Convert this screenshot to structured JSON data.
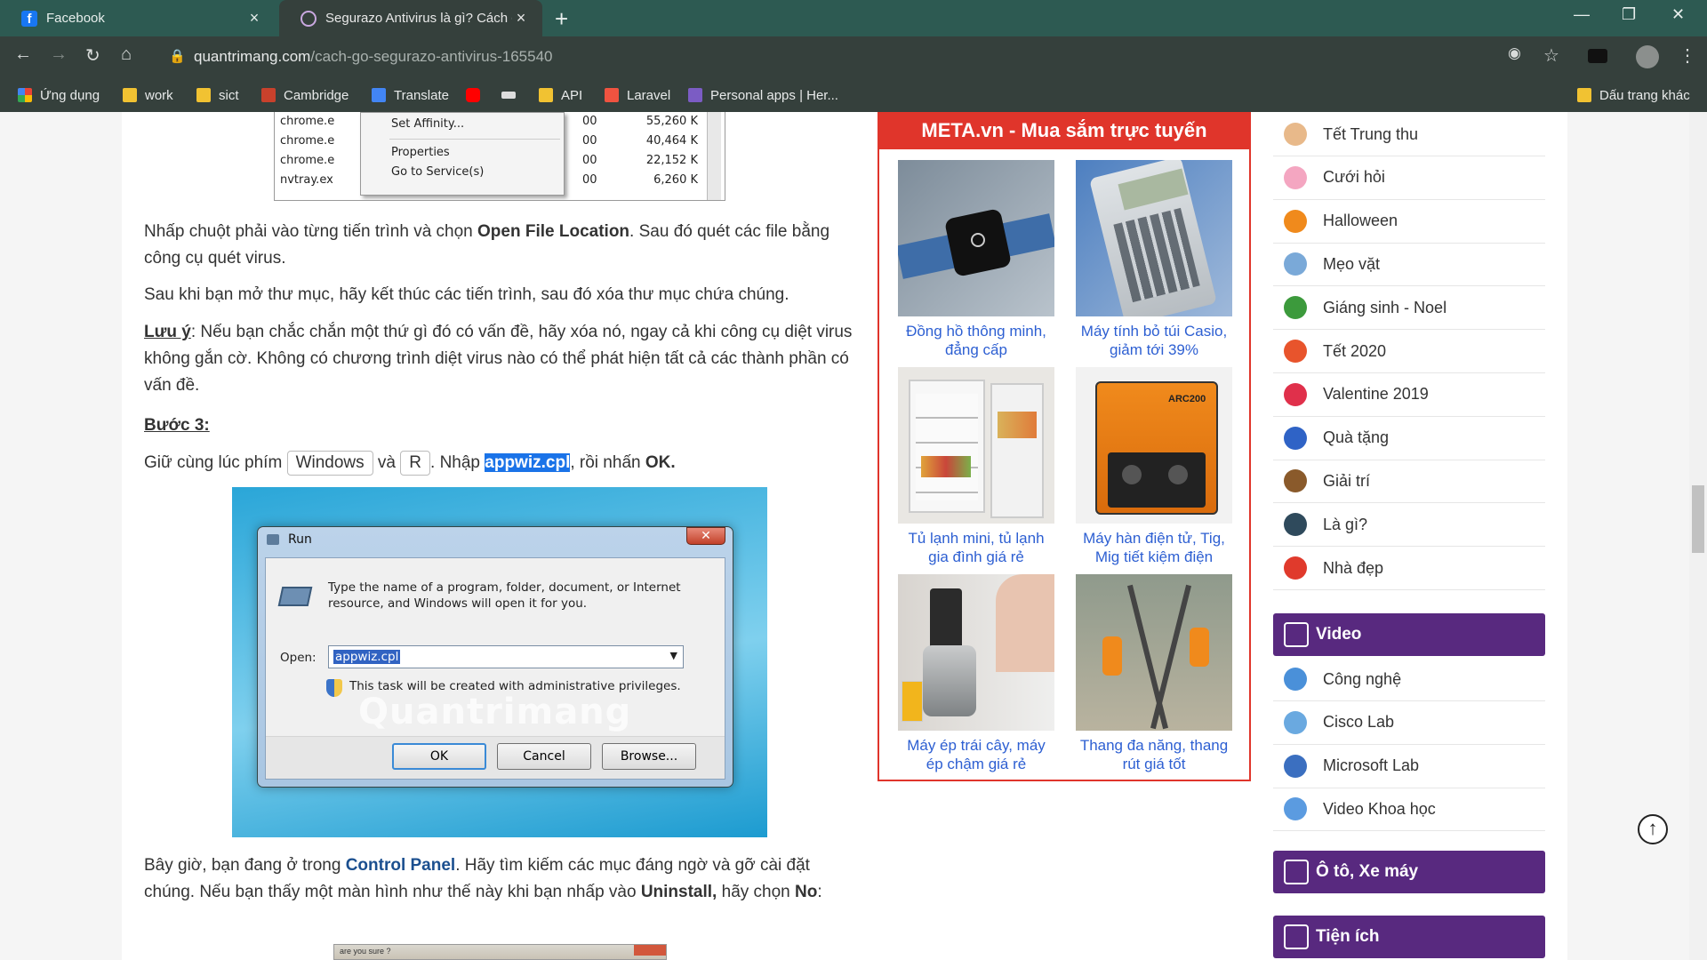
{
  "tabs": [
    {
      "title": "Facebook",
      "close": "×"
    },
    {
      "title": "Segurazo Antivirus là gì? Cách gỡ",
      "close": "×"
    }
  ],
  "new_tab": "+",
  "window_controls": {
    "minimize": "—",
    "maximize": "❐",
    "close": "✕"
  },
  "address": {
    "domain": "quantrimang.com",
    "path": "/cach-go-segurazo-antivirus-165540"
  },
  "bookmarks": [
    {
      "label": "Ứng dụng",
      "icon": "apps-grid-icon"
    },
    {
      "label": "work",
      "icon": "folder-icon"
    },
    {
      "label": "sict",
      "icon": "folder-icon"
    },
    {
      "label": "Cambridge",
      "icon": "cambridge-icon"
    },
    {
      "label": "Translate",
      "icon": "translate-icon"
    },
    {
      "label": "",
      "icon": "youtube-icon"
    },
    {
      "label": "",
      "icon": "bookmark-icon"
    },
    {
      "label": "API",
      "icon": "folder-icon"
    },
    {
      "label": "Laravel",
      "icon": "laravel-icon"
    },
    {
      "label": "Personal apps | Her...",
      "icon": "heroku-icon"
    }
  ],
  "other_bookmarks": "Dấu trang khác",
  "article": {
    "screenshot_top": {
      "menu_items": [
        "Set Affinity...",
        "Properties",
        "Go to Service(s)"
      ],
      "rows": [
        {
          "name": "chrome.e",
          "cpu": "00",
          "mem": "55,260 K"
        },
        {
          "name": "chrome.e",
          "cpu": "00",
          "mem": "40,464 K"
        },
        {
          "name": "chrome.e",
          "cpu": "00",
          "mem": "22,152 K"
        },
        {
          "name": "nvtray.ex",
          "cpu": "00",
          "mem": "6,260 K"
        }
      ]
    },
    "p1_a": "Nhấp chuột phải vào từng tiến trình và chọn ",
    "p1_b": "Open File Location",
    "p1_c": ". Sau đó quét các file bằng công cụ quét virus.",
    "p2": "Sau khi bạn mở thư mục, hãy kết thúc các tiến trình, sau đó xóa thư mục chứa chúng.",
    "p3_label": "Lưu ý",
    "p3_text": ": Nếu bạn chắc chắn một thứ gì đó có vấn đề, hãy xóa nó, ngay cả khi công cụ diệt virus không gắn cờ. Không có chương trình diệt virus nào có thể phát hiện tất cả các thành phần có vấn đề.",
    "step3": "Bước 3:",
    "p4_a": "Giữ cùng lúc phím ",
    "p4_key1": "Windows",
    "p4_b": " và ",
    "p4_key2": "R",
    "p4_c": ". Nhập ",
    "p4_sel": "appwiz.cpl",
    "p4_d": ", rồi nhấn ",
    "p4_ok": "OK.",
    "run_dialog": {
      "title": "Run",
      "desc": "Type the name of a program, folder, document, or Internet resource, and Windows will open it for you.",
      "open_label": "Open:",
      "open_value": "appwiz.cpl",
      "admin_note": "This task will be created with administrative privileges.",
      "ok": "OK",
      "cancel": "Cancel",
      "browse": "Browse...",
      "watermark": "Quantrimang"
    },
    "p5_a": "Bây giờ, bạn đang ở trong ",
    "p5_b": "Control Panel",
    "p5_c": ". Hãy tìm kiếm các mục đáng ngờ và gỡ cài đặt chúng. Nếu bạn thấy một màn hình như thế này khi bạn nhấp vào ",
    "p5_d": "Uninstall,",
    "p5_e": " hãy chọn ",
    "p5_f": "No",
    "p5_g": ":",
    "bottom_img_text": "are you sure ?"
  },
  "meta": {
    "heading": "META.vn - Mua sắm trực tuyến",
    "products": [
      {
        "caption": "Đồng hồ thông minh, đẳng cấp",
        "icon": "smartwatch-image"
      },
      {
        "caption": "Máy tính bỏ túi Casio, giảm tới 39%",
        "icon": "calculator-image"
      },
      {
        "caption": "Tủ lạnh mini, tủ lạnh gia đình giá rẻ",
        "icon": "fridge-image"
      },
      {
        "caption": "Máy hàn điện tử, Tig, Mig tiết kiệm điện",
        "icon": "welder-image"
      },
      {
        "caption": "Máy ép trái cây, máy ép chậm giá rẻ",
        "icon": "juicer-image"
      },
      {
        "caption": "Thang đa năng, thang rút giá tốt",
        "icon": "ladder-image"
      }
    ],
    "welder_label": "ARC200"
  },
  "sidebar": {
    "items": [
      {
        "label": "Tết Trung thu",
        "color": "#e8b98a"
      },
      {
        "label": "Cưới hỏi",
        "color": "#f4a6c1"
      },
      {
        "label": "Halloween",
        "color": "#f08a1c"
      },
      {
        "label": "Mẹo vặt",
        "color": "#7aa9d8"
      },
      {
        "label": "Giáng sinh - Noel",
        "color": "#3c9a3c"
      },
      {
        "label": "Tết 2020",
        "color": "#e8542c"
      },
      {
        "label": "Valentine 2019",
        "color": "#e0304b"
      },
      {
        "label": "Quà tặng",
        "color": "#2f63c6"
      },
      {
        "label": "Giải trí",
        "color": "#8a5a2b"
      },
      {
        "label": "Là gì?",
        "color": "#2f4a5c"
      },
      {
        "label": "Nhà đẹp",
        "color": "#e03a2c"
      }
    ],
    "video_head": "Video",
    "video_items": [
      {
        "label": "Công nghệ",
        "color": "#4a90d9"
      },
      {
        "label": "Cisco Lab",
        "color": "#6aa9e0"
      },
      {
        "label": "Microsoft Lab",
        "color": "#3b6fc0"
      },
      {
        "label": "Video Khoa học",
        "color": "#5b9be0"
      }
    ],
    "auto_head": "Ô tô, Xe máy",
    "util_head": "Tiện ích"
  },
  "back_to_top": "↑"
}
